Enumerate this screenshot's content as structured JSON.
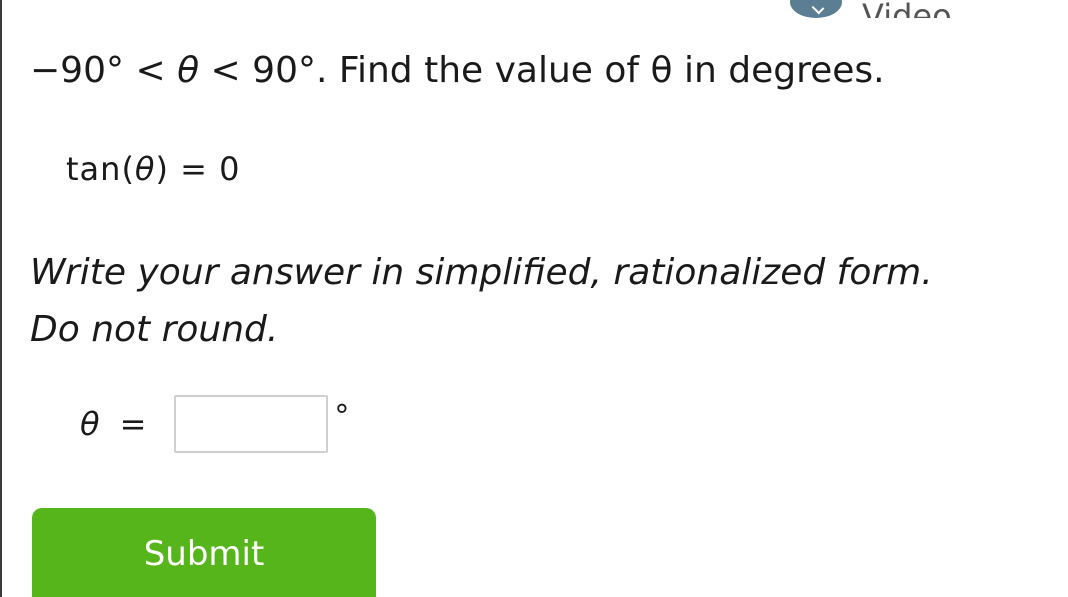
{
  "header": {
    "video_label": "Video",
    "video_icon": "check-circle-icon"
  },
  "problem": {
    "lower_bound": "−90°",
    "lt1": "<",
    "variable": "θ",
    "lt2": "<",
    "upper_bound": "90°",
    "statement": ". Find the value of θ in degrees."
  },
  "equation": {
    "function": "tan",
    "open_paren": "(",
    "variable": "θ",
    "close_paren": ")",
    "equals": "=",
    "value": "0"
  },
  "instructions": {
    "line1": "Write your answer in simplified, rationalized form.",
    "line2": "Do not round."
  },
  "answer": {
    "variable": "θ",
    "equals": "=",
    "input_value": "",
    "degree_symbol": "°"
  },
  "submit": {
    "label": "Submit"
  },
  "colors": {
    "submit_background": "#56b51b",
    "video_icon": "#5b7e93"
  }
}
